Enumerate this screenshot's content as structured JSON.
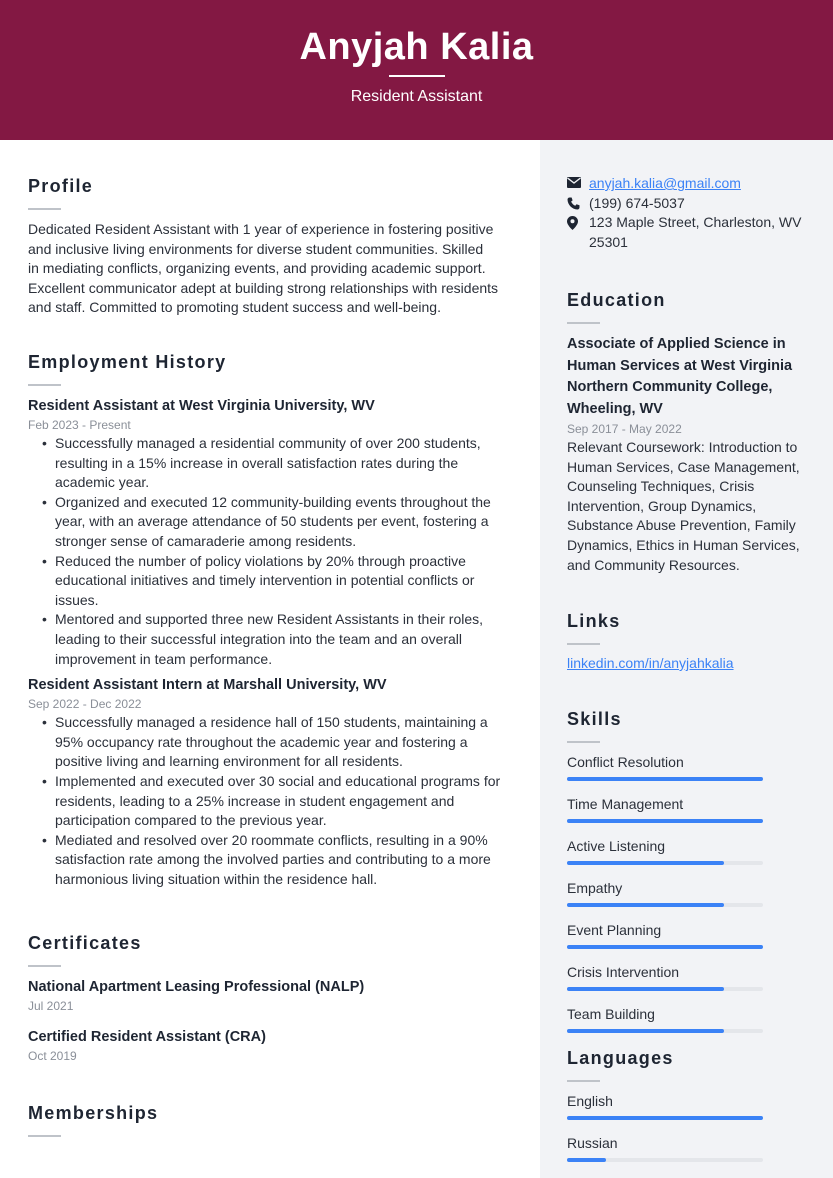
{
  "header": {
    "name": "Anyjah Kalia",
    "title": "Resident Assistant",
    "background_color": "#831843"
  },
  "profile": {
    "heading": "Profile",
    "lines": [
      "Dedicated Resident Assistant with 1 year of experience in fostering positive",
      "and inclusive living environments for diverse student communities. Skilled",
      "in mediating conflicts, organizing events, and providing academic support.",
      "Excellent communicator adept at building strong relationships with residents",
      "and staff. Committed to promoting student success and well-being."
    ]
  },
  "employment": {
    "heading": "Employment History",
    "jobs": [
      {
        "title": "Resident Assistant at West Virginia University, WV",
        "dates": "Feb 2023 - Present",
        "bullets": [
          "Successfully managed a residential community of over 200 students, resulting in a 15% increase in overall satisfaction rates during the academic year.",
          "Organized and executed 12 community-building events throughout the year, with an average attendance of 50 students per event, fostering a stronger sense of camaraderie among residents.",
          "Reduced the number of policy violations by 20% through proactive educational initiatives and timely intervention in potential conflicts or issues.",
          "Mentored and supported three new Resident Assistants in their roles, leading to their successful integration into the team and an overall improvement in team performance."
        ]
      },
      {
        "title": "Resident Assistant Intern at Marshall University, WV",
        "dates": "Sep 2022 - Dec 2022",
        "bullets": [
          "Successfully managed a residence hall of 150 students, maintaining a 95% occupancy rate throughout the academic year and fostering a positive living and learning environment for all residents.",
          "Implemented and executed over 30 social and educational programs for residents, leading to a 25% increase in student engagement and participation compared to the previous year.",
          "Mediated and resolved over 20 roommate conflicts, resulting in a 90% satisfaction rate among the involved parties and contributing to a more harmonious living situation within the residence hall."
        ]
      }
    ]
  },
  "certificates": {
    "heading": "Certificates",
    "items": [
      {
        "name": "National Apartment Leasing Professional (NALP)",
        "date": "Jul 2021"
      },
      {
        "name": "Certified Resident Assistant (CRA)",
        "date": "Oct 2019"
      }
    ]
  },
  "memberships": {
    "heading": "Memberships"
  },
  "contact": {
    "email": "anyjah.kalia@gmail.com",
    "phone": "(199) 674-5037",
    "address_line1": "123 Maple Street, Charleston, WV",
    "address_line2": "25301",
    "icons": [
      "envelope-icon",
      "phone-icon",
      "map-pin-icon"
    ]
  },
  "education": {
    "heading": "Education",
    "degree": "Associate of Applied Science in Human Services at West Virginia Northern Community College, Wheeling, WV",
    "dates": "Sep 2017 - May 2022",
    "coursework": "Relevant Coursework: Introduction to Human Services, Case Management, Counseling Techniques, Crisis Intervention, Group Dynamics, Substance Abuse Prevention, Family Dynamics, Ethics in Human Services, and Community Resources."
  },
  "links": {
    "heading": "Links",
    "items": [
      {
        "label": "linkedin.com/in/anyjahkalia"
      }
    ]
  },
  "skills": {
    "heading": "Skills",
    "accent_color": "#3b82f6",
    "items": [
      {
        "label": "Conflict Resolution",
        "level": 1.0
      },
      {
        "label": "Time Management",
        "level": 1.0
      },
      {
        "label": "Active Listening",
        "level": 0.8
      },
      {
        "label": "Empathy",
        "level": 0.8
      },
      {
        "label": "Event Planning",
        "level": 1.0
      },
      {
        "label": "Crisis Intervention",
        "level": 0.8
      },
      {
        "label": "Team Building",
        "level": 0.8
      }
    ]
  },
  "languages": {
    "heading": "Languages",
    "items": [
      {
        "label": "English",
        "level": 1.0
      },
      {
        "label": "Russian",
        "level": 0.2
      }
    ]
  }
}
